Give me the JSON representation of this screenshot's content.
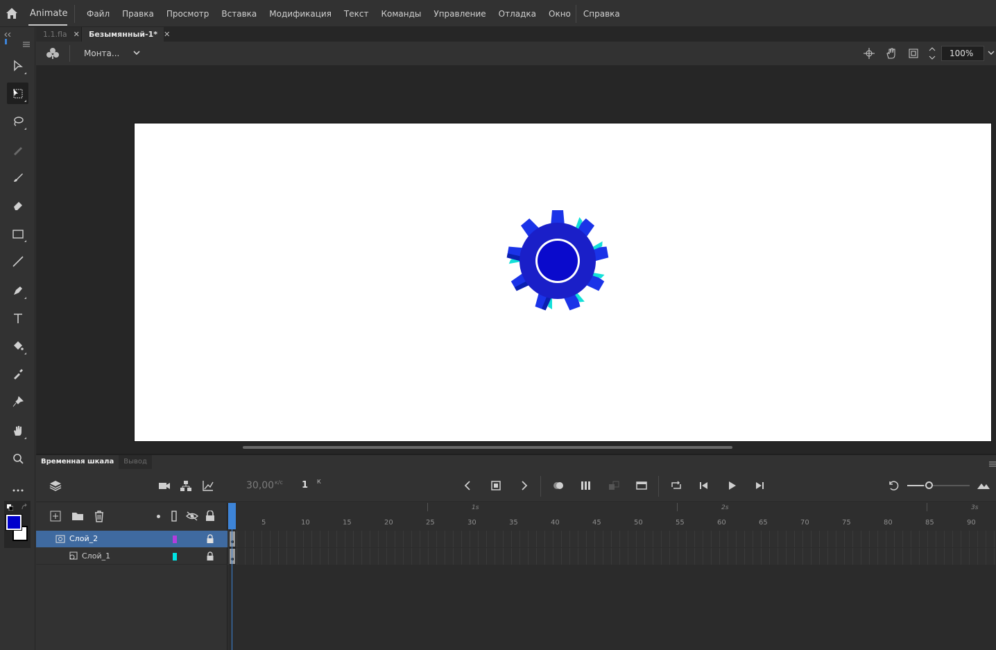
{
  "app": {
    "name": "Animate"
  },
  "menu": [
    "Файл",
    "Правка",
    "Просмотр",
    "Вставка",
    "Модификация",
    "Текст",
    "Команды",
    "Управление",
    "Отладка",
    "Окно",
    "Справка"
  ],
  "tabs": [
    {
      "label": "1.1.fla",
      "active": false
    },
    {
      "label": "Безымянный-1*",
      "active": true
    }
  ],
  "tab_close_glyph": "✕",
  "editbar": {
    "scene_label": "Монта...",
    "zoom": "100%"
  },
  "timeline": {
    "tabs": [
      "Временная шкала",
      "Вывод"
    ],
    "fps": "30,00",
    "fps_unit": "к/с",
    "current_frame": "1",
    "frame_unit": "К",
    "seconds": [
      "1s",
      "2s",
      "3s"
    ],
    "frame_labels": [
      "5",
      "10",
      "15",
      "20",
      "25",
      "30",
      "35",
      "40",
      "45",
      "50",
      "55",
      "60",
      "65",
      "70",
      "75",
      "80",
      "85",
      "90"
    ],
    "layers": [
      {
        "name": "Слой_2",
        "selected": true,
        "color": "#b23ddd",
        "locked": true
      },
      {
        "name": "Слой_1",
        "selected": false,
        "color": "#00e5e5",
        "locked": true
      }
    ]
  },
  "colors": {
    "fill": "#0000cc",
    "stroke": "#ffffff",
    "accent": "#3d84d8"
  },
  "stage": {
    "background": "#ffffff",
    "object": "gear-graphic"
  }
}
